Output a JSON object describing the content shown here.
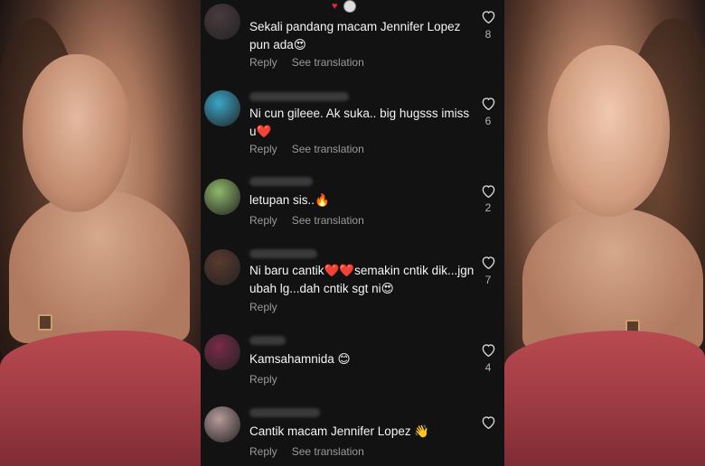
{
  "comments": [
    {
      "text": "Sekali pandang macam Jennifer Lopez pun ada😍",
      "likes": "8",
      "reply": "Reply",
      "translate": "See translation",
      "avatar_color": "#4a3a3e"
    },
    {
      "text": "Ni cun gileee. Ak suka.. big hugsss imiss u❤️",
      "likes": "6",
      "reply": "Reply",
      "translate": "See translation",
      "avatar_color": "#3aa6c8"
    },
    {
      "text": "letupan sis..🔥",
      "likes": "2",
      "reply": "Reply",
      "translate": "See translation",
      "avatar_color": "#8fb86a"
    },
    {
      "text": "Ni baru cantik❤️❤️semakin cntik dik...jgn ubah lg...dah cntik sgt ni😍",
      "likes": "7",
      "reply": "Reply",
      "avatar_color": "#5a3a2e"
    },
    {
      "text": "Kamsahamnida 😊",
      "likes": "4",
      "reply": "Reply",
      "avatar_color": "#7a2a48"
    },
    {
      "text": "Cantik macam Jennifer Lopez 👋",
      "likes": "",
      "reply": "Reply",
      "translate": "See translation",
      "avatar_color": "#b89a9a"
    }
  ],
  "colors": {
    "background": "#121212",
    "muted": "#9a9a9a",
    "heart_outline": "#d8d8d8",
    "accent_red": "#e0243a"
  },
  "icons": {
    "like": "heart-outline-icon"
  }
}
